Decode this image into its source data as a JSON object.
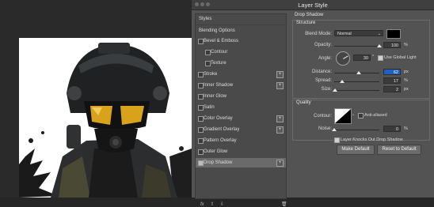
{
  "dialog": {
    "title": "Layer Style"
  },
  "styles_panel": {
    "header": "Styles",
    "items": [
      {
        "label": "Blending Options",
        "kind": "header",
        "checked": false,
        "plus": false
      },
      {
        "label": "Bevel & Emboss",
        "kind": "main",
        "checked": false,
        "plus": false
      },
      {
        "label": "Contour",
        "kind": "sub",
        "checked": false,
        "plus": false
      },
      {
        "label": "Texture",
        "kind": "sub",
        "checked": false,
        "plus": false
      },
      {
        "label": "Stroke",
        "kind": "main",
        "checked": false,
        "plus": true
      },
      {
        "label": "Inner Shadow",
        "kind": "main",
        "checked": false,
        "plus": true
      },
      {
        "label": "Inner Glow",
        "kind": "main",
        "checked": false,
        "plus": false
      },
      {
        "label": "Satin",
        "kind": "main",
        "checked": false,
        "plus": false
      },
      {
        "label": "Color Overlay",
        "kind": "main",
        "checked": false,
        "plus": true
      },
      {
        "label": "Gradient Overlay",
        "kind": "main",
        "checked": false,
        "plus": true
      },
      {
        "label": "Pattern Overlay",
        "kind": "main",
        "checked": false,
        "plus": false
      },
      {
        "label": "Outer Glow",
        "kind": "main",
        "checked": false,
        "plus": false
      },
      {
        "label": "Drop Shadow",
        "kind": "main",
        "checked": true,
        "plus": true,
        "selected": true
      }
    ],
    "footer": {
      "fx": "fx",
      "up": "⇧",
      "down": "⇩",
      "trash": "🗑"
    }
  },
  "drop_shadow": {
    "title": "Drop Shadow",
    "structure": {
      "title": "Structure",
      "blend_mode_label": "Blend Mode:",
      "blend_mode_value": "Normal",
      "shadow_color": "#000000",
      "opacity_label": "Opacity:",
      "opacity_value": "100",
      "opacity_fraction": 1.0,
      "percent": "%",
      "angle_label": "Angle:",
      "angle_value": "30",
      "degree": "°",
      "use_global_light_label": "Use Global Light",
      "use_global_light_checked": true,
      "distance_label": "Distance:",
      "distance_value": "62",
      "distance_fraction": 0.55,
      "spread_label": "Spread:",
      "spread_value": "17",
      "spread_fraction": 0.17,
      "size_label": "Size:",
      "size_value": "2",
      "size_fraction": 0.02,
      "px": "px"
    },
    "quality": {
      "title": "Quality",
      "contour_label": "Contour:",
      "anti_aliased_label": "Anti-aliased",
      "anti_aliased_checked": false,
      "noise_label": "Noise:",
      "noise_value": "0",
      "noise_fraction": 0.0,
      "percent": "%"
    },
    "knockout_label": "Layer Knocks Out Drop Shadow",
    "knockout_checked": true,
    "make_default": "Make Default",
    "reset_to_default": "Reset to Default"
  },
  "colors": {
    "dialog_bg": "#535353",
    "highlight": "#1f5fbf",
    "visor": "#d9a21b",
    "artboard": "#ffffff"
  }
}
